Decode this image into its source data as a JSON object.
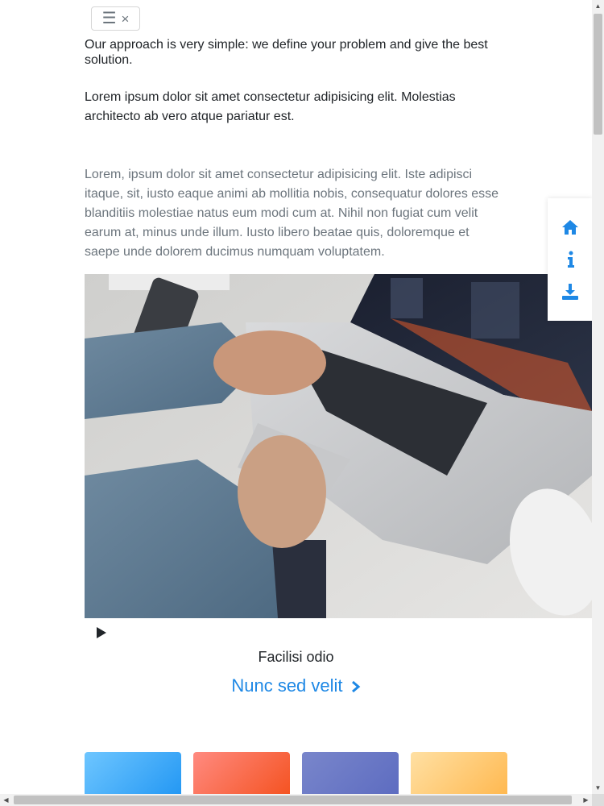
{
  "nav": {
    "menu_glyph": "☰",
    "close_glyph": "×"
  },
  "intro": {
    "approach": "Our approach is very simple: we define your problem and give the best solution.",
    "lorem_short": "Lorem ipsum dolor sit amet consectetur adipisicing elit. Molestias architecto ab vero atque pariatur est.",
    "lorem_long": "Lorem, ipsum dolor sit amet consectetur adipisicing elit. Iste adipisci itaque, sit, iusto eaque animi ab mollitia nobis, consequatur dolores esse blanditiis molestiae natus eum modi cum at. Nihil non fugiat cum velit earum at, minus unde illum. Iusto libero beatae quis, doloremque et saepe unde dolorem ducimus numquam voluptatem."
  },
  "media": {
    "caption": "Facilisi odio",
    "cta_label": "Nunc sed velit"
  },
  "side_nav": {
    "icons": [
      "home-icon",
      "info-icon",
      "download-icon"
    ],
    "accent": "#1e88e5"
  },
  "cards": [
    {
      "color_from": "#6ec6ff",
      "color_to": "#2196f3"
    },
    {
      "color_from": "#ff8a80",
      "color_to": "#f4511e"
    },
    {
      "color_from": "#7986cb",
      "color_to": "#5c6bc0"
    },
    {
      "color_from": "#ffe0a3",
      "color_to": "#ffb74d"
    }
  ]
}
